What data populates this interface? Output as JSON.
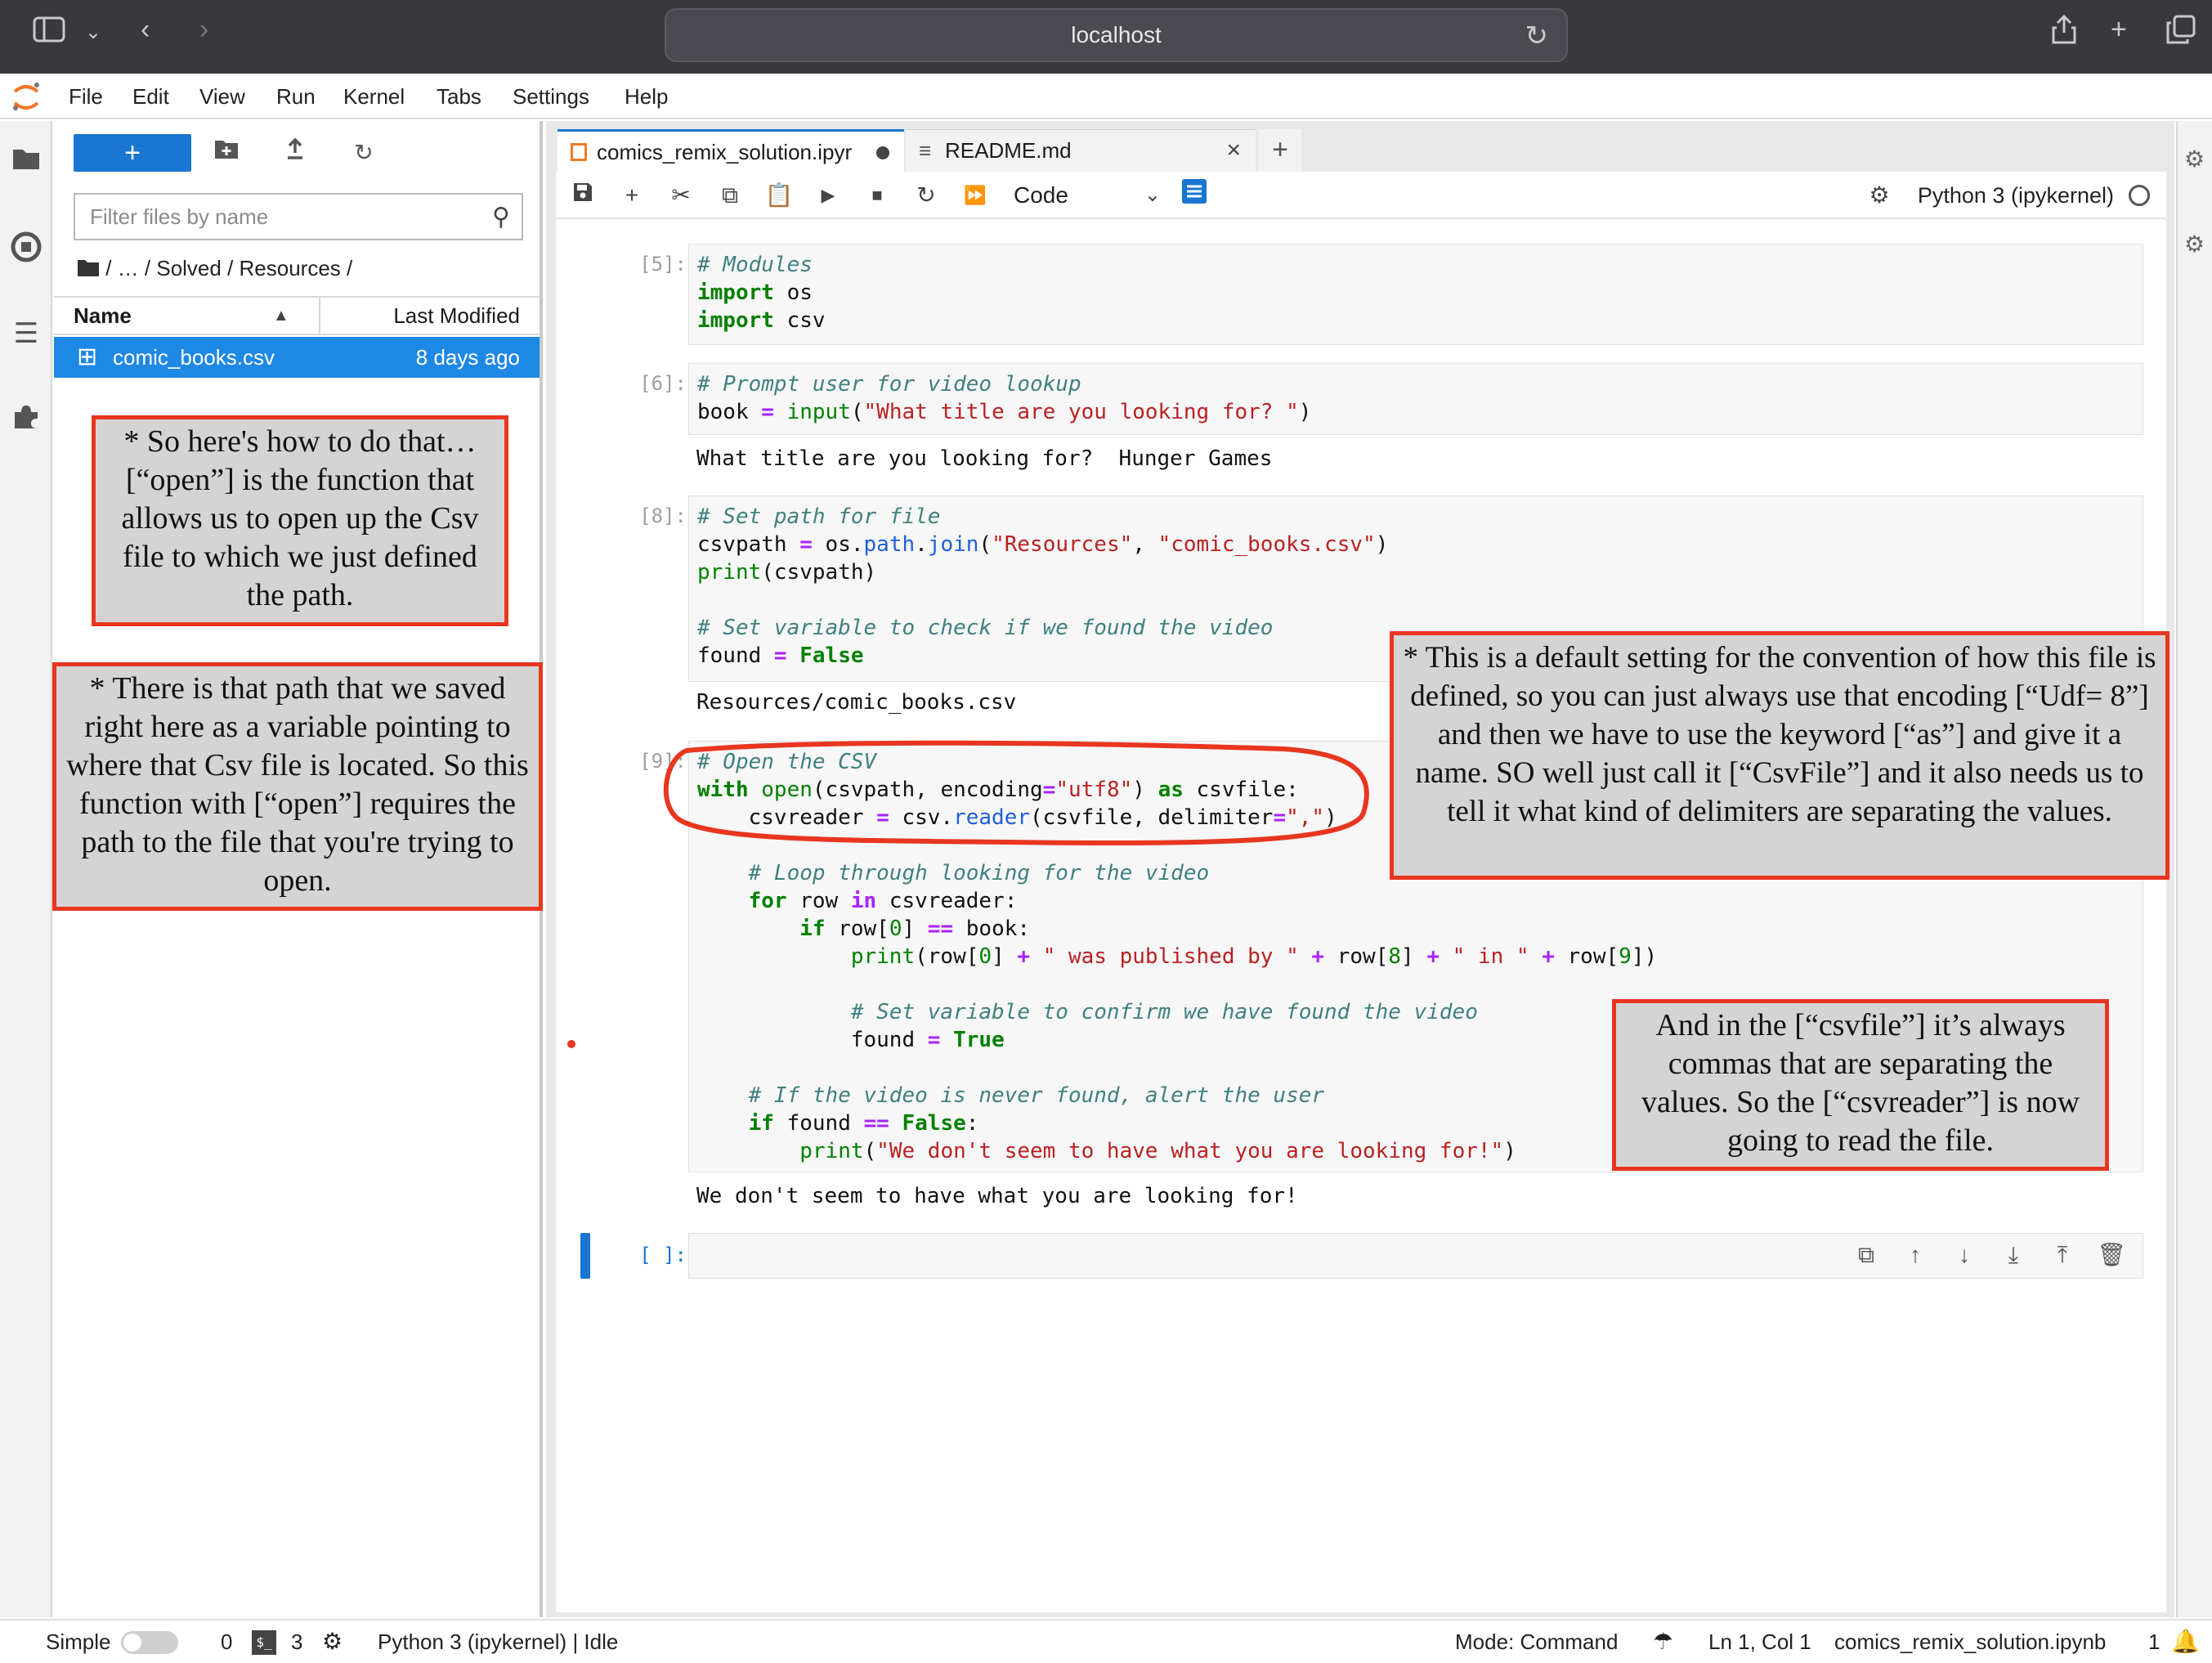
{
  "browser": {
    "url": "localhost",
    "icons": [
      "sidebar-icon",
      "chevron-down-icon",
      "back-icon",
      "forward-icon",
      "reload-icon",
      "share-icon",
      "new-tab-icon",
      "tabs-overview-icon"
    ]
  },
  "menu": {
    "items": [
      "File",
      "Edit",
      "View",
      "Run",
      "Kernel",
      "Tabs",
      "Settings",
      "Help"
    ]
  },
  "filebrowser": {
    "new_button": "+",
    "filter_placeholder": "Filter files by name",
    "breadcrumb": "/   …   / Solved / Resources /",
    "col_name": "Name",
    "col_modified": "Last Modified",
    "files": [
      {
        "name": "comic_books.csv",
        "modified": "8 days ago"
      }
    ]
  },
  "notes": {
    "left_top": "* So here's how to do that… [“open”] is the function that allows us to open up the Csv file to which we just defined the path.",
    "left_bottom": "* There is that path that we saved right here as a variable pointing to where that Csv file is located. So this function with [“open”] requires the path to the file that you're trying to open.",
    "right_top": "* This is a default setting for the convention of how this file is defined, so you can just always use that encoding [“Udf= 8”] and then we have to use the keyword [“as”] and give it a name. SO well just call it [“CsvFile”] and it also needs us to tell it what kind of delimiters are separating the values.",
    "right_bottom": "And in the [“csvfile”] it’s always commas that are separating the values. So the [“csvreader”] is now going to read the file."
  },
  "tabs": [
    {
      "title": "comics_remix_solution.ipyr",
      "active": true
    },
    {
      "title": "README.md",
      "active": false
    }
  ],
  "toolbar": {
    "cell_type": "Code",
    "kernel": "Python 3 (ipykernel)"
  },
  "cells": [
    {
      "prompt": "[5]:",
      "output": ""
    },
    {
      "prompt": "[6]:",
      "output": "What title are you looking for?  Hunger Games"
    },
    {
      "prompt": "[8]:",
      "output": "Resources/comic_books.csv"
    },
    {
      "prompt": "[9]:",
      "output": "We don't seem to have what you are looking for!"
    },
    {
      "prompt": "[ ]:",
      "output": ""
    }
  ],
  "statusbar": {
    "mode_label": "Simple",
    "terminals": "0",
    "kernels": "3",
    "kernel_status": "Python 3 (ipykernel) | Idle",
    "mode": "Mode: Command",
    "position": "Ln 1, Col 1",
    "filename": "comics_remix_solution.ipynb",
    "notifications": "1"
  },
  "colors": {
    "accent": "#1976d2",
    "annotation_border": "#e8361f",
    "annotation_bg": "#d4d4d4"
  }
}
